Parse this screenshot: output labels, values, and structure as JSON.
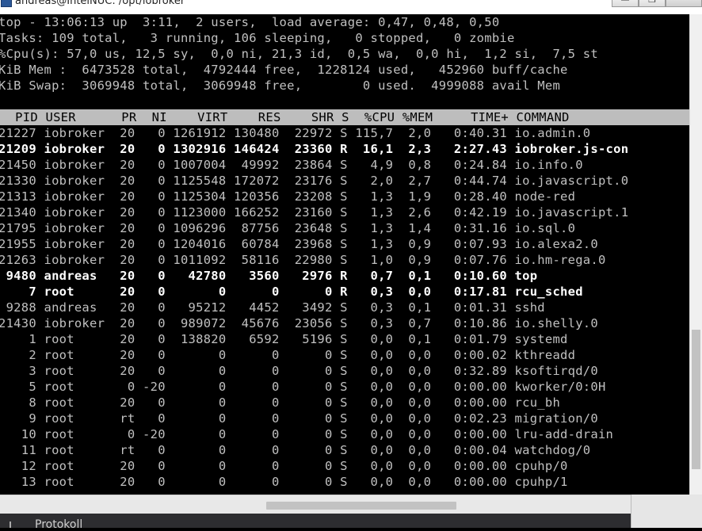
{
  "window": {
    "title": "andreas@IntelNUC: /opt/iobroker",
    "buttons": {
      "minimize": "—",
      "maximize": "❐",
      "close": ""
    }
  },
  "summary": [
    "top - 13:06:13 up  3:11,  2 users,  load average: 0,47, 0,48, 0,50",
    "Tasks: 109 total,   3 running, 106 sleeping,   0 stopped,   0 zombie",
    "%Cpu(s): 57,0 us, 12,5 sy,  0,0 ni, 21,3 id,  0,5 wa,  0,0 hi,  1,2 si,  7,5 st",
    "KiB Mem :  6473528 total,  4792444 free,  1228124 used,   452960 buff/cache",
    "KiB Swap:  3069948 total,  3069948 free,        0 used.  4999088 avail Mem"
  ],
  "table_header": "  PID USER      PR  NI    VIRT    RES    SHR S  %CPU %MEM     TIME+ COMMAND",
  "processes": [
    {
      "line": "21227 iobroker  20   0 1261912 130480  22972 S 115,7  2,0   0:40.31 io.admin.0",
      "bold": false
    },
    {
      "line": "21209 iobroker  20   0 1302916 146424  23360 R  16,1  2,3   2:27.43 iobroker.js-con",
      "bold": true
    },
    {
      "line": "21450 iobroker  20   0 1007004  49992  23864 S   4,9  0,8   0:24.84 io.info.0",
      "bold": false
    },
    {
      "line": "21330 iobroker  20   0 1125548 172072  23176 S   2,0  2,7   0:44.74 io.javascript.0",
      "bold": false
    },
    {
      "line": "21313 iobroker  20   0 1125304 120356  23208 S   1,3  1,9   0:28.40 node-red",
      "bold": false
    },
    {
      "line": "21340 iobroker  20   0 1123000 166252  23160 S   1,3  2,6   0:42.19 io.javascript.1",
      "bold": false
    },
    {
      "line": "21795 iobroker  20   0 1096296  87756  23648 S   1,3  1,4   0:31.16 io.sql.0",
      "bold": false
    },
    {
      "line": "21955 iobroker  20   0 1204016  60784  23968 S   1,3  0,9   0:07.93 io.alexa2.0",
      "bold": false
    },
    {
      "line": "21263 iobroker  20   0 1011092  58116  22980 S   1,0  0,9   0:07.76 io.hm-rega.0",
      "bold": false
    },
    {
      "line": " 9480 andreas   20   0   42780   3560   2976 R   0,7  0,1   0:10.60 top",
      "bold": true
    },
    {
      "line": "    7 root      20   0       0      0      0 R   0,3  0,0   0:17.81 rcu_sched",
      "bold": true
    },
    {
      "line": " 9288 andreas   20   0   95212   4452   3492 S   0,3  0,1   0:01.31 sshd",
      "bold": false
    },
    {
      "line": "21430 iobroker  20   0  989072  45676  23056 S   0,3  0,7   0:10.86 io.shelly.0",
      "bold": false
    },
    {
      "line": "    1 root      20   0  138820   6592   5196 S   0,0  0,1   0:01.79 systemd",
      "bold": false
    },
    {
      "line": "    2 root      20   0       0      0      0 S   0,0  0,0   0:00.02 kthreadd",
      "bold": false
    },
    {
      "line": "    3 root      20   0       0      0      0 S   0,0  0,0   0:32.89 ksoftirqd/0",
      "bold": false
    },
    {
      "line": "    5 root       0 -20       0      0      0 S   0,0  0,0   0:00.00 kworker/0:0H",
      "bold": false
    },
    {
      "line": "    8 root      20   0       0      0      0 S   0,0  0,0   0:00.00 rcu_bh",
      "bold": false
    },
    {
      "line": "    9 root      rt   0       0      0      0 S   0,0  0,0   0:02.23 migration/0",
      "bold": false
    },
    {
      "line": "   10 root       0 -20       0      0      0 S   0,0  0,0   0:00.00 lru-add-drain",
      "bold": false
    },
    {
      "line": "   11 root      rt   0       0      0      0 S   0,0  0,0   0:00.04 watchdog/0",
      "bold": false
    },
    {
      "line": "   12 root      20   0       0      0      0 S   0,0  0,0   0:00.00 cpuhp/0",
      "bold": false
    },
    {
      "line": "   13 root      20   0       0      0      0 S   0,0  0,0   0:00.00 cpuhp/1",
      "bold": false
    }
  ],
  "bottom_panel": {
    "tab_label": "Protokoll"
  },
  "colors": {
    "terminal_bg": "#000000",
    "text": "#c0c0c0",
    "bold_text": "#ffffff",
    "header_bg": "#bdbdbd"
  }
}
